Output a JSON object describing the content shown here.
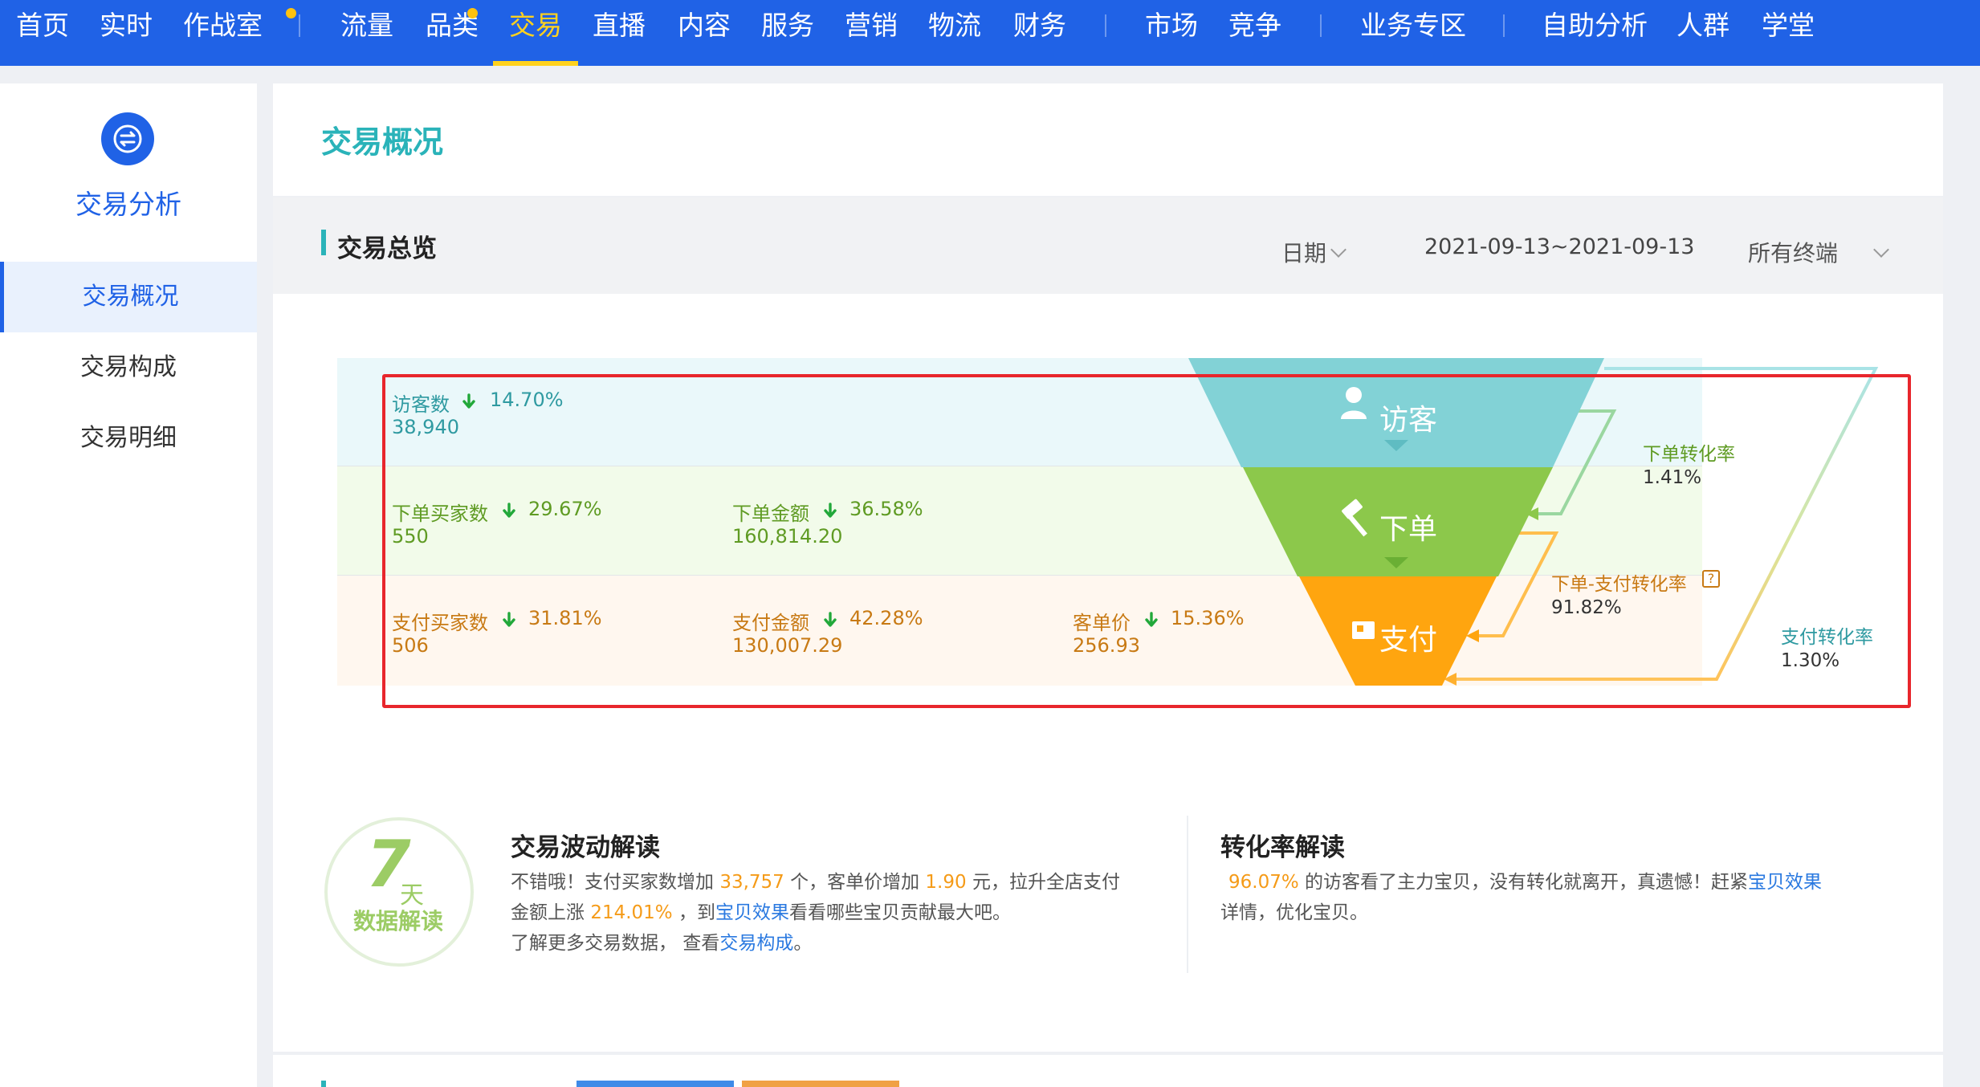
{
  "nav": {
    "items": [
      {
        "label": "首页"
      },
      {
        "label": "实时"
      },
      {
        "label": "作战室"
      },
      {
        "label": "流量"
      },
      {
        "label": "品类"
      },
      {
        "label": "交易"
      },
      {
        "label": "直播"
      },
      {
        "label": "内容"
      },
      {
        "label": "服务"
      },
      {
        "label": "营销"
      },
      {
        "label": "物流"
      },
      {
        "label": "财务"
      },
      {
        "label": "市场"
      },
      {
        "label": "竞争"
      },
      {
        "label": "业务专区"
      },
      {
        "label": "自助分析"
      },
      {
        "label": "人群"
      },
      {
        "label": "学堂"
      }
    ],
    "active": "交易"
  },
  "sidebar": {
    "title": "交易分析",
    "items": [
      {
        "label": "交易概况"
      },
      {
        "label": "交易构成"
      },
      {
        "label": "交易明细"
      }
    ]
  },
  "header": {
    "title": "交易概况"
  },
  "overview": {
    "title": "交易总览",
    "date_label": "日期",
    "date_range": "2021-09-13~2021-09-13",
    "terminal_label": "所有终端"
  },
  "funnel": {
    "visitor": {
      "label": "访客",
      "metrics": [
        {
          "name": "访客数",
          "pct": "14.70%",
          "value": "38,940"
        }
      ]
    },
    "order": {
      "label": "下单",
      "metrics": [
        {
          "name": "下单买家数",
          "pct": "29.67%",
          "value": "550"
        },
        {
          "name": "下单金额",
          "pct": "36.58%",
          "value": "160,814.20"
        }
      ]
    },
    "pay": {
      "label": "支付",
      "metrics": [
        {
          "name": "支付买家数",
          "pct": "31.81%",
          "value": "506"
        },
        {
          "name": "支付金额",
          "pct": "42.28%",
          "value": "130,007.29"
        },
        {
          "name": "客单价",
          "pct": "15.36%",
          "value": "256.93"
        }
      ]
    },
    "rates": {
      "order_rate": {
        "label": "下单转化率",
        "value": "1.41%"
      },
      "order_pay_rate": {
        "label": "下单-支付转化率",
        "value": "91.82%"
      },
      "pay_rate": {
        "label": "支付转化率",
        "value": "1.30%"
      }
    },
    "colors": {
      "visitor": "#82d2d6",
      "order": "#8cc84b",
      "pay": "#ffa50f"
    }
  },
  "interpretation": {
    "badge_number": "7",
    "badge_unit": "天",
    "badge_text": "数据解读",
    "wave": {
      "title": "交易波动解读",
      "line1": {
        "t1": "不错哦！支付买家数增加 ",
        "n1": "33,757",
        "t2": " 个，客单价增加 ",
        "n2": "1.90",
        "t3": " 元，拉升全店支付"
      },
      "line2": {
        "t1": "金额上涨 ",
        "n1": "214.01%",
        "t2": " ，到",
        "link": "宝贝效果",
        "t3": "看看哪些宝贝贡献最大吧。"
      },
      "line3": {
        "t1": "了解更多交易数据，  查看",
        "link": "交易构成",
        "t2": "。"
      }
    },
    "conversion": {
      "title": "转化率解读",
      "line1": {
        "n1": "96.07%",
        "t1": " 的访客看了主力宝贝，没有转化就离开，真遗憾！赶紧",
        "link": "宝贝效果"
      },
      "line2": "详情，优化宝贝。"
    }
  }
}
